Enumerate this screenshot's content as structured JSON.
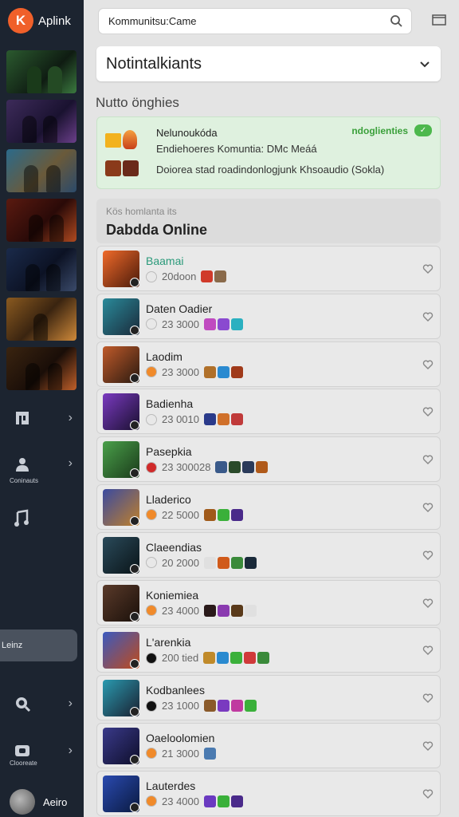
{
  "brand": {
    "logo_letter": "K",
    "name": "Aplink"
  },
  "sidebar": {
    "nav": [
      {
        "icon": "bookmark-icon",
        "label": ""
      },
      {
        "icon": "community-icon",
        "label": "Coninauts"
      },
      {
        "icon": "music-icon",
        "label": ""
      }
    ],
    "active_label": "Leinz",
    "bottom_nav": [
      {
        "icon": "search-icon",
        "label": ""
      },
      {
        "icon": "chat-icon",
        "label": "Clooreate"
      }
    ],
    "user_name": "Aeiro"
  },
  "search": {
    "value": "Kommunitsu:Came",
    "icon": "search-icon"
  },
  "select": {
    "value": "Notintalkiants"
  },
  "section_title": "Nutto önghies",
  "notification": {
    "title": "Nelunoukóda",
    "subtitle": "Endiehoeres Komuntia: DMc Meáá",
    "detail": "Doiorea stad roadindonlogjunk Khsoaudio (Sokla)",
    "tag": "ndoglienties",
    "badge": "✓"
  },
  "online": {
    "subtitle": "Kös homlanta its",
    "title": "Dabdda Online"
  },
  "members": [
    {
      "name": "Baamai",
      "count": "20doon"
    },
    {
      "name": "Daten Oadier",
      "count": "23 3000"
    },
    {
      "name": "Laodim",
      "count": "23 3000"
    },
    {
      "name": "Badienha",
      "count": "23 0010"
    },
    {
      "name": "Pasepkia",
      "count": "23 300028"
    },
    {
      "name": "Lladerico",
      "count": "22 5000"
    },
    {
      "name": "Claeendias",
      "count": "20 2000"
    },
    {
      "name": "Koniemiea",
      "count": "23 4000"
    },
    {
      "name": "L'arenkia",
      "count": "200 tied"
    },
    {
      "name": "Kodbanlees",
      "count": "23 1000"
    },
    {
      "name": "Oaeloolomien",
      "count": "21 3000"
    },
    {
      "name": "Lauterdes",
      "count": "23 4000"
    }
  ],
  "colors": {
    "brand": "#f0602a",
    "sidebar": "#1c2430",
    "accent_green": "#4db84d"
  }
}
